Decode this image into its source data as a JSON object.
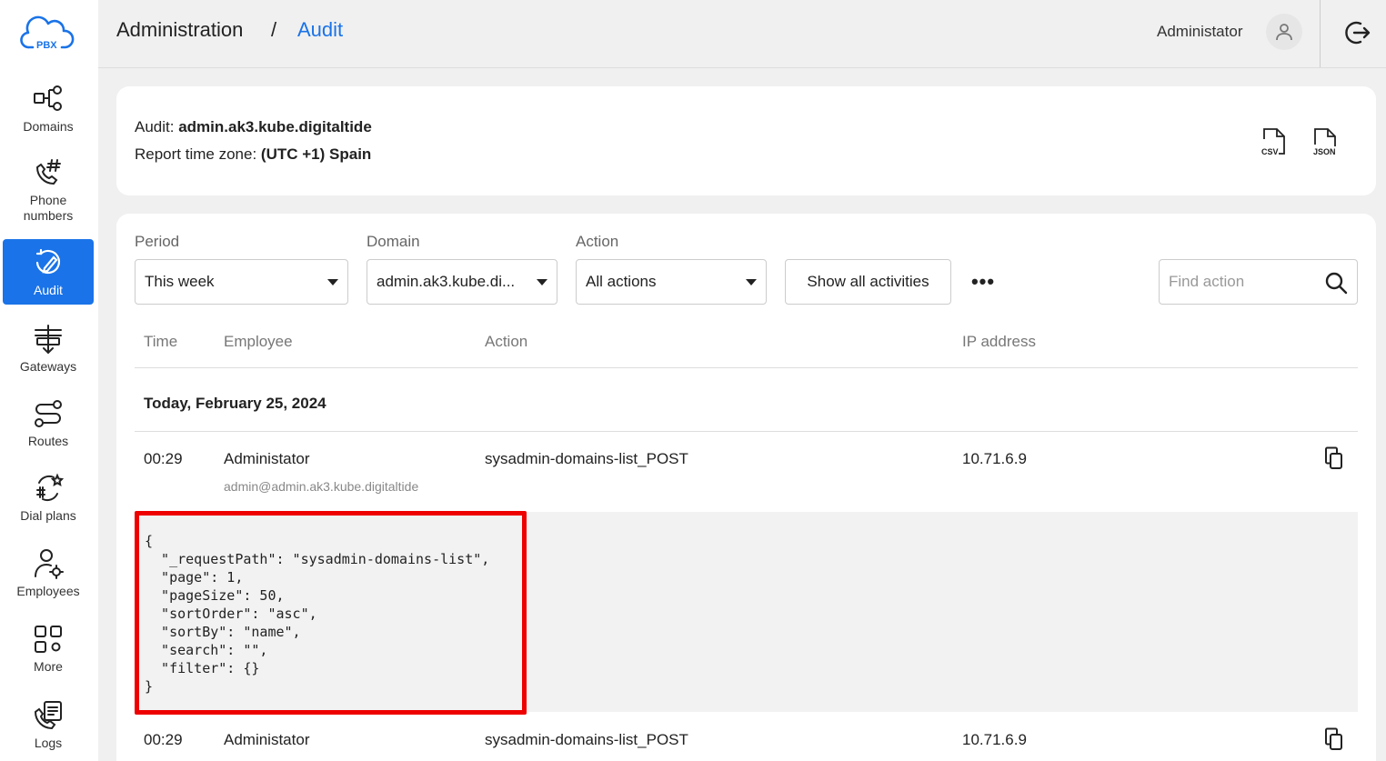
{
  "app": {
    "logo_text": "PBX"
  },
  "sidebar": {
    "items": [
      {
        "label": "Domains"
      },
      {
        "label": "Phone numbers"
      },
      {
        "label": "Audit"
      },
      {
        "label": "Gateways"
      },
      {
        "label": "Routes"
      },
      {
        "label": "Dial plans"
      },
      {
        "label": "Employees"
      },
      {
        "label": "More"
      },
      {
        "label": "Logs"
      }
    ],
    "active_index": 2
  },
  "header": {
    "breadcrumb_root": "Administration",
    "breadcrumb_separator": "/",
    "breadcrumb_current": "Audit",
    "user_name": "Administator"
  },
  "info": {
    "audit_label": "Audit:",
    "audit_value": "admin.ak3.kube.digitaltide",
    "timezone_label": "Report time zone:",
    "timezone_value": "(UTC +1) Spain",
    "export_csv": "CSV",
    "export_json": "JSON"
  },
  "filters": {
    "period_label": "Period",
    "period_value": "This week",
    "domain_label": "Domain",
    "domain_value": "admin.ak3.kube.di...",
    "action_label": "Action",
    "action_value": "All actions",
    "show_all_label": "Show all activities",
    "more_label": "•••",
    "search_placeholder": "Find action"
  },
  "table": {
    "columns": [
      "Time",
      "Employee",
      "Action",
      "IP address"
    ],
    "group_date": "Today, February 25, 2024",
    "rows": [
      {
        "time": "00:29",
        "employee": "Administator",
        "employee_email": "admin@admin.ak3.kube.digitaltide",
        "action": "sysadmin-domains-list_POST",
        "ip": "10.71.6.9",
        "details": "{\n  \"_requestPath\": \"sysadmin-domains-list\",\n  \"page\": 1,\n  \"pageSize\": 50,\n  \"sortOrder\": \"asc\",\n  \"sortBy\": \"name\",\n  \"search\": \"\",\n  \"filter\": {}\n}"
      },
      {
        "time": "00:29",
        "employee": "Administator",
        "action": "sysadmin-domains-list_POST",
        "ip": "10.71.6.9"
      }
    ]
  },
  "colors": {
    "accent": "#1a73e8",
    "highlight": "#ee0000",
    "background": "#f0f0f0"
  }
}
